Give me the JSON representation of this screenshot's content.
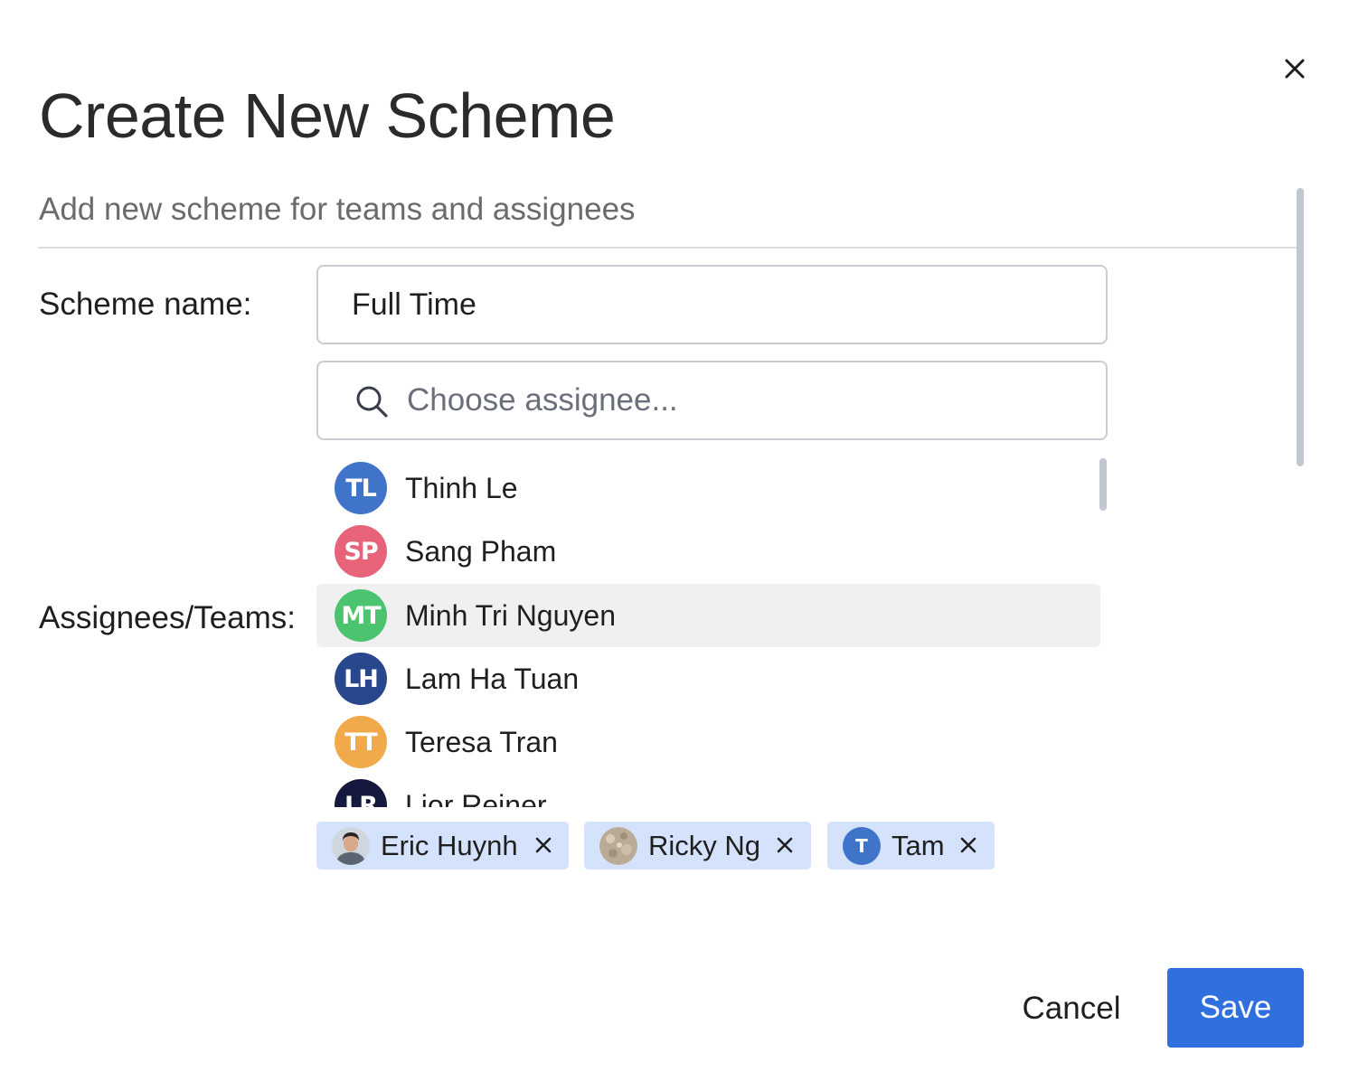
{
  "dialog": {
    "title": "Create New Scheme",
    "subtitle": "Add new scheme for teams and assignees"
  },
  "form": {
    "scheme_name_label": "Scheme name:",
    "scheme_name_value": "Full Time",
    "assignees_label": "Assignees/Teams:",
    "search_placeholder": "Choose assignee..."
  },
  "assignee_list": [
    {
      "initials": "TL",
      "name": "Thinh Le",
      "color": "#3f74c8",
      "highlighted": false
    },
    {
      "initials": "SP",
      "name": "Sang Pham",
      "color": "#e7637a",
      "highlighted": false
    },
    {
      "initials": "MT",
      "name": "Minh Tri Nguyen",
      "color": "#4cc46f",
      "highlighted": true
    },
    {
      "initials": "LH",
      "name": "Lam Ha Tuan",
      "color": "#29478c",
      "highlighted": false
    },
    {
      "initials": "TT",
      "name": "Teresa Tran",
      "color": "#f0aa4a",
      "highlighted": false
    },
    {
      "initials": "LR",
      "name": "Lior Reiner",
      "color": "#15193d",
      "highlighted": false
    }
  ],
  "selected_chips": [
    {
      "name": "Eric Huynh",
      "avatar_type": "photo-person"
    },
    {
      "name": "Ricky Ng",
      "avatar_type": "photo-texture"
    },
    {
      "name": "Tam",
      "avatar_type": "initial",
      "initial": "T",
      "color": "#3f74c8"
    }
  ],
  "actions": {
    "cancel_label": "Cancel",
    "save_label": "Save"
  },
  "colors": {
    "primary": "#2f6fde",
    "chip_bg": "#d4e3fb",
    "hover_bg": "#f0f0f0"
  }
}
